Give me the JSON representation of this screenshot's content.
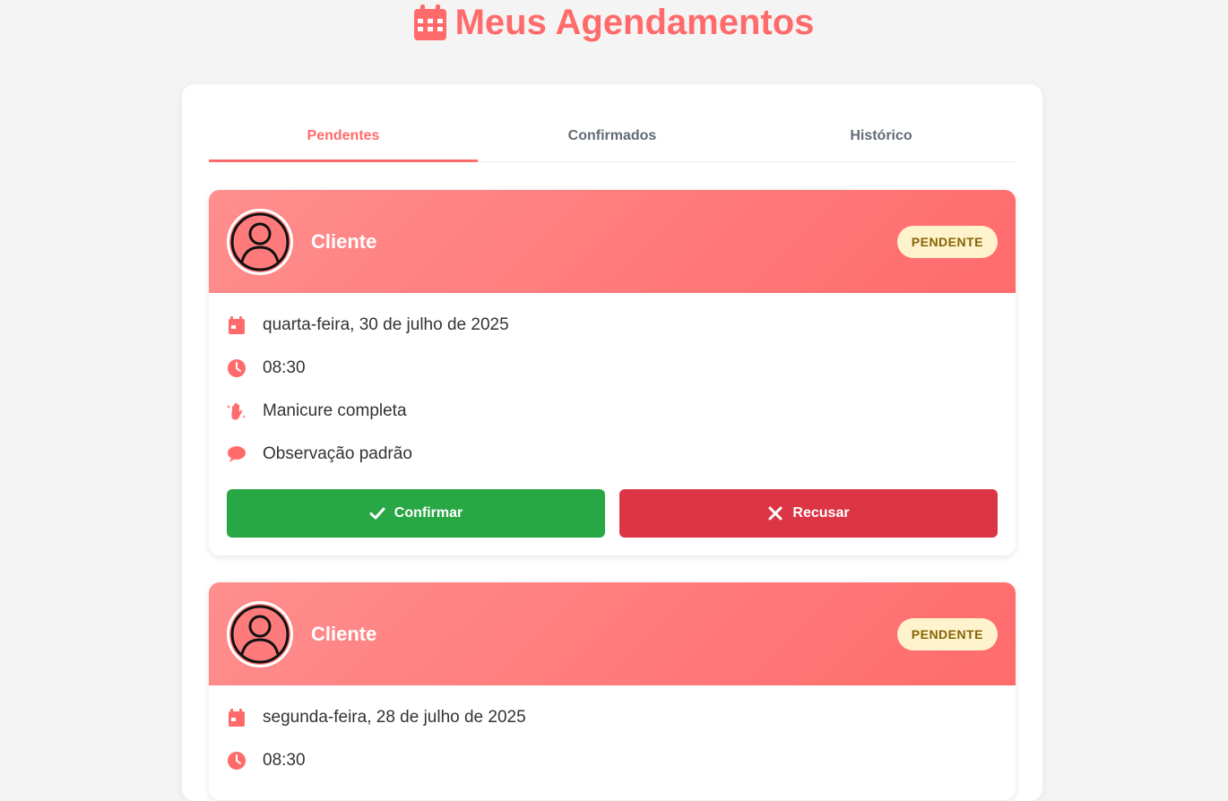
{
  "header": {
    "title": "Meus Agendamentos",
    "icon": "calendar-icon",
    "color": "#ff6b6b"
  },
  "tabs": [
    {
      "label": "Pendentes",
      "active": true
    },
    {
      "label": "Confirmados",
      "active": false
    },
    {
      "label": "Histórico",
      "active": false
    }
  ],
  "appointments": [
    {
      "client": "Cliente",
      "status": "PENDENTE",
      "date": "quarta-feira, 30 de julho de 2025",
      "time": "08:30",
      "service": "Manicure completa",
      "note": "Observação padrão",
      "confirm_label": "Confirmar",
      "refuse_label": "Recusar"
    },
    {
      "client": "Cliente",
      "status": "PENDENTE",
      "date": "segunda-feira, 28 de julho de 2025",
      "time": "08:30"
    }
  ],
  "colors": {
    "accent": "#ff6b6b",
    "confirm": "#28a745",
    "refuse": "#dc3545",
    "badge_bg": "#fff3cd",
    "badge_text": "#856404"
  }
}
